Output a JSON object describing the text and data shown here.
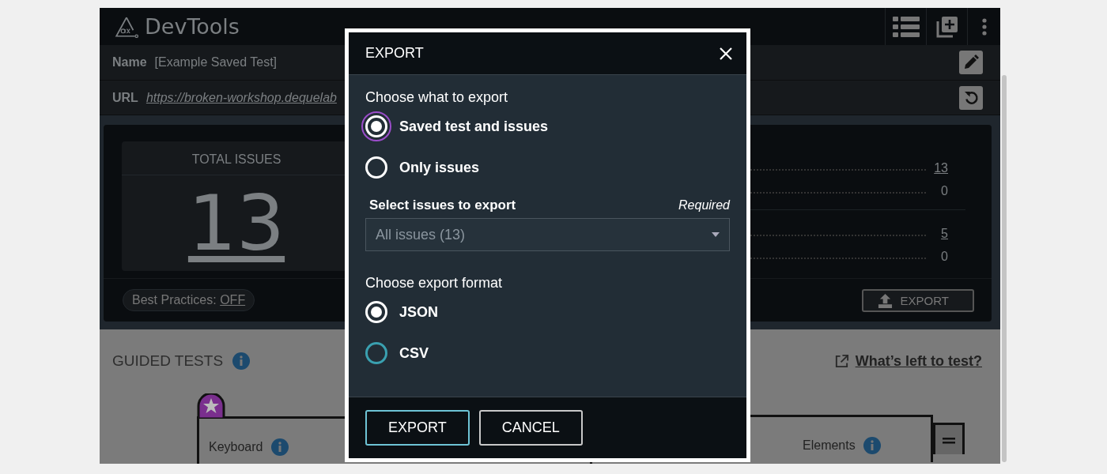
{
  "app": {
    "title": "DevTools",
    "name_label": "Name",
    "name_value": "[Example Saved Test]",
    "url_label": "URL",
    "url_value": "https://broken-workshop.dequelab",
    "summary": {
      "title": "TOTAL ISSUES",
      "total": "13",
      "counts": [
        {
          "value": "13",
          "link": true
        },
        {
          "value": "0",
          "link": false
        },
        {
          "value": "5",
          "link": true
        },
        {
          "value": "0",
          "link": false
        }
      ],
      "best_practices_label": "Best Practices:",
      "best_practices_value": "OFF",
      "export_button": "EXPORT"
    },
    "guided_tests": {
      "title": "GUIDED TESTS",
      "link": "What’s left to test?",
      "cards": [
        {
          "label": "Keyboard",
          "starred": true
        },
        {
          "label": "Elements",
          "starred": false
        }
      ]
    }
  },
  "dialog": {
    "title": "EXPORT",
    "scope_label": "Choose what to export",
    "scope_options": [
      {
        "label": "Saved test and issues",
        "selected": true,
        "focused": true
      },
      {
        "label": "Only issues",
        "selected": false,
        "focused": false
      }
    ],
    "issues_label": "Select issues to export",
    "required": "Required",
    "issues_select": "All issues (13)",
    "format_label": "Choose export format",
    "format_options": [
      {
        "label": "JSON",
        "selected": true,
        "hovered": false
      },
      {
        "label": "CSV",
        "selected": false,
        "hovered": true
      }
    ],
    "buttons": [
      {
        "label": "EXPORT",
        "kind": "primary"
      },
      {
        "label": "CANCEL",
        "kind": "secondary"
      }
    ]
  }
}
